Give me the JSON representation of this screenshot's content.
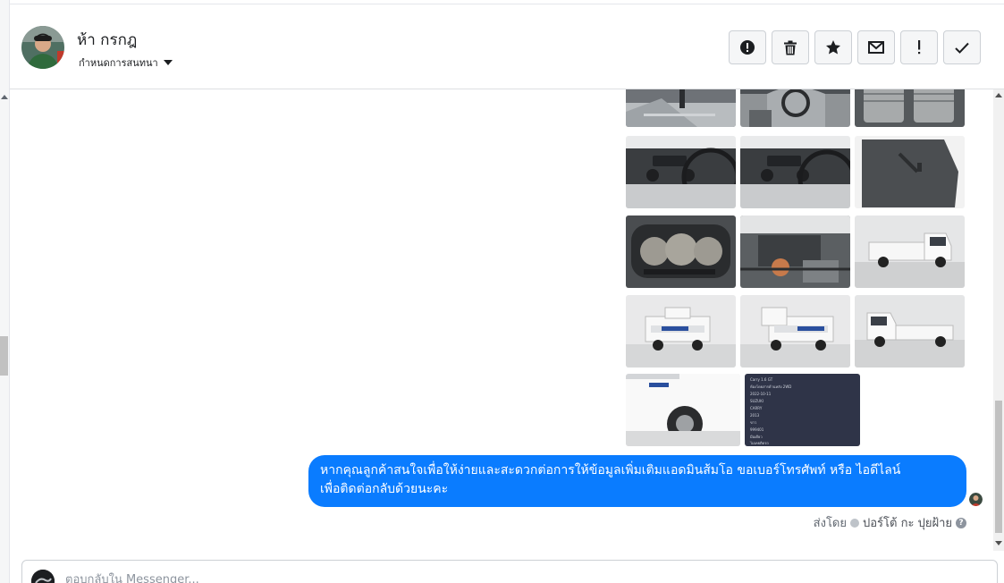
{
  "conversation": {
    "contact_name": "ห้า กรกฎ",
    "assign_label": "กำหนดการสนทนา"
  },
  "actions": [
    {
      "name": "report-spam",
      "icon": "alert-circle-icon"
    },
    {
      "name": "delete",
      "icon": "trash-icon"
    },
    {
      "name": "star",
      "icon": "star-icon"
    },
    {
      "name": "mark-unread",
      "icon": "envelope-icon"
    },
    {
      "name": "mark-important",
      "icon": "exclamation-icon"
    },
    {
      "name": "mark-done",
      "icon": "check-icon"
    }
  ],
  "gallery": {
    "image_count": 14,
    "spec_card_lines": [
      "Carry 1.6 GT",
      "ห้องโดยสารด้านหลัง 2WD",
      "2022-10-11",
      "SUZUKI",
      "CARRY",
      "2013",
      "ขาว",
      "999401",
      "มือเดียว",
      "ไม่เคยติดรถ"
    ]
  },
  "message": {
    "text_line1": "หากคุณลูกค้าสนใจเพื่อให้ง่ายและสะดวกต่อการให้ข้อมูลเพิ่มเติมแอดมินส้มโอ ขอเบอร์โทรศัพท์ หรือ ไอดีไลน์",
    "text_line2": "เพื่อติดต่อกลับด้วยนะคะ",
    "sent_by_label": "ส่งโดย",
    "sent_by_name": "ปอร์โต้ กะ ปุยฝ้าย"
  },
  "reply": {
    "placeholder": "ตอบกลับใน Messenger..."
  },
  "colors": {
    "bubble": "#0a7cff",
    "border": "#ccd0d5"
  }
}
